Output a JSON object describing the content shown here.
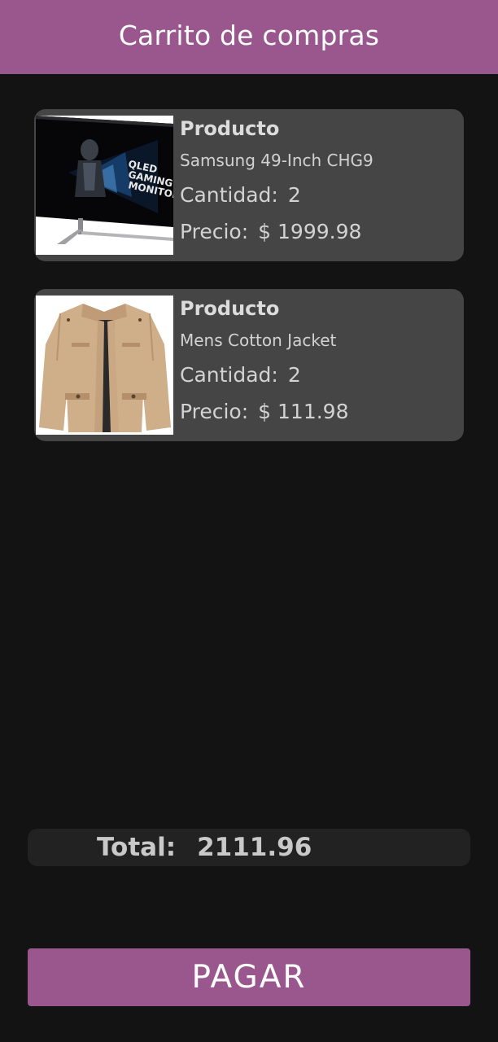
{
  "header": {
    "title": "Carrito de compras"
  },
  "cart": {
    "items": [
      {
        "heading": "Producto",
        "name": "Samsung 49-Inch CHG9",
        "quantity_label": "Cantidad:",
        "quantity": "2",
        "price_label": "Precio:",
        "price": "$ 1999.98",
        "image_icon": "monitor-image",
        "image_text": [
          "QLED",
          "GAMING",
          "MONITOR"
        ]
      },
      {
        "heading": "Producto",
        "name": "Mens Cotton Jacket",
        "quantity_label": "Cantidad:",
        "quantity": "2",
        "price_label": "Precio:",
        "price": "$ 111.98",
        "image_icon": "jacket-image"
      }
    ]
  },
  "summary": {
    "total_label": "Total:",
    "total_value": "2111.96"
  },
  "actions": {
    "pay_label": "PAGAR"
  },
  "colors": {
    "accent": "#9a578e",
    "background": "#131313",
    "card": "#454545",
    "total_bar": "#222222"
  }
}
